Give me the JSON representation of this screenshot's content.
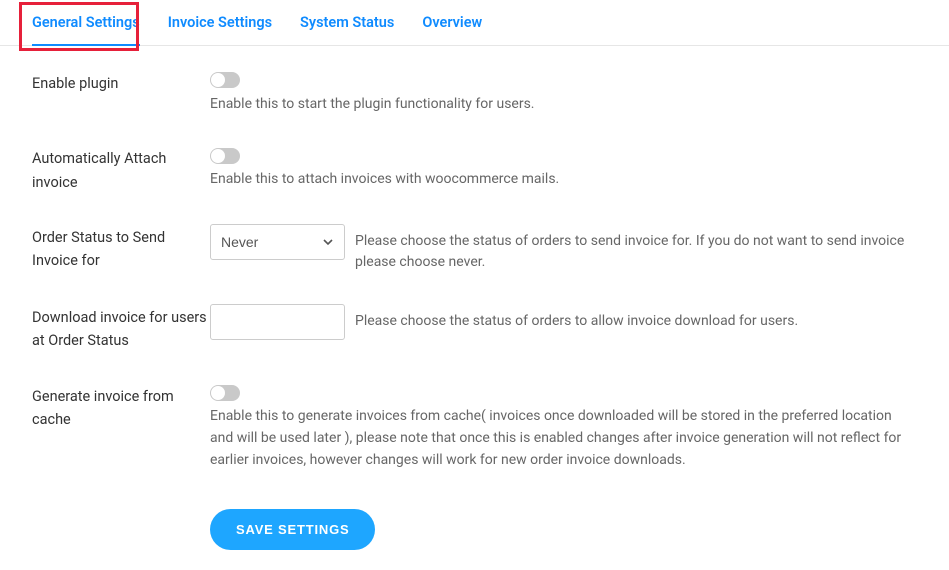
{
  "tabs": {
    "general": "General Settings",
    "invoice": "Invoice Settings",
    "system": "System Status",
    "overview": "Overview"
  },
  "rows": {
    "enable_plugin": {
      "label": "Enable plugin",
      "help": "Enable this to start the plugin functionality for users."
    },
    "auto_attach": {
      "label": "Automatically Attach invoice",
      "help": "Enable this to attach invoices with woocommerce mails."
    },
    "order_status_send": {
      "label": "Order Status to Send Invoice for",
      "select_value": "Never",
      "help": "Please choose the status of orders to send invoice for. If you do not want to send invoice please choose never."
    },
    "download_status": {
      "label": "Download invoice for users at Order Status",
      "input_value": "",
      "help": "Please choose the status of orders to allow invoice download for users."
    },
    "cache": {
      "label": "Generate invoice from cache",
      "help": "Enable this to generate invoices from cache( invoices once downloaded will be stored in the preferred location and will be used later ), please note that once this is enabled changes after invoice generation will not reflect for earlier invoices, however changes will work for new order invoice downloads."
    }
  },
  "buttons": {
    "save": "SAVE SETTINGS"
  }
}
